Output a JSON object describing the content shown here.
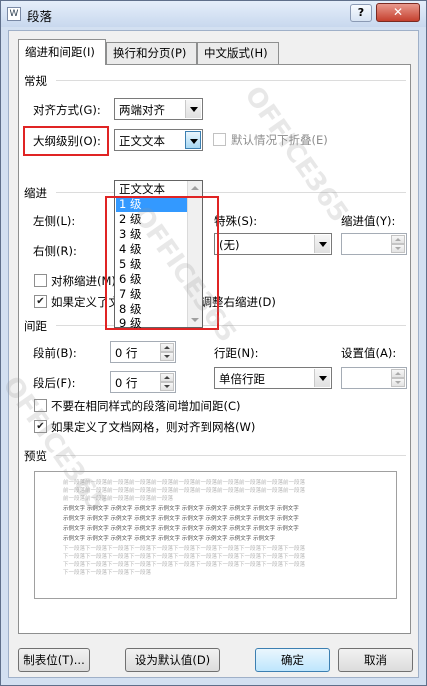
{
  "window": {
    "title": "段落",
    "help_label": "?",
    "close_label": "✕"
  },
  "tabs": [
    {
      "label": "缩进和间距(I)"
    },
    {
      "label": "换行和分页(P)"
    },
    {
      "label": "中文版式(H)"
    }
  ],
  "general": {
    "heading": "常规",
    "alignment_label": "对齐方式(G):",
    "alignment_value": "两端对齐",
    "outline_label": "大纲级别(O):",
    "outline_value": "正文文本",
    "collapsed_label": "默认情况下折叠(E)"
  },
  "outline_dropdown": {
    "options": [
      "正文文本",
      "1 级",
      "2 级",
      "3 级",
      "4 级",
      "5 级",
      "6 级",
      "7 级",
      "8 级",
      "9 级"
    ],
    "selected_index": 1
  },
  "indent": {
    "heading": "缩进",
    "left_label": "左侧(L):",
    "right_label": "右侧(R):",
    "special_label": "特殊(S):",
    "special_value": "(无)",
    "indent_value_label": "缩进值(Y):",
    "mirror_label": "对称缩进(M)",
    "auto_adjust_label": "如果定义了文档网格，则自动调整右缩进(D)"
  },
  "spacing": {
    "heading": "间距",
    "before_label": "段前(B):",
    "before_value": "0 行",
    "after_label": "段后(F):",
    "after_value": "0 行",
    "line_label": "行距(N):",
    "line_value": "单倍行距",
    "set_value_label": "设置值(A):",
    "no_space_same_style_label": "不要在相同样式的段落间增加间距(C)",
    "snap_grid_label": "如果定义了文档网格，则对齐到网格(W)"
  },
  "preview": {
    "heading": "预览",
    "prev_lines": [
      "前一段落前一段落前一段落前一段落前一段落前一段落前一段落前一段落前一段落前一段落前一段落",
      "前一段落前一段落前一段落前一段落前一段落前一段落前一段落前一段落前一段落前一段落前一段落",
      "前一段落前一段落前一段落前一段落前一段落"
    ],
    "sample_lines": [
      "示例文字 示例文字 示例文字 示例文字 示例文字 示例文字 示例文字 示例文字 示例文字 示例文字",
      "示例文字 示例文字 示例文字 示例文字 示例文字 示例文字 示例文字 示例文字 示例文字 示例文字",
      "示例文字 示例文字 示例文字 示例文字 示例文字 示例文字 示例文字 示例文字 示例文字 示例文字",
      "示例文字 示例文字 示例文字 示例文字 示例文字 示例文字 示例文字 示例文字 示例文字"
    ],
    "next_lines": [
      "下一段落下一段落下一段落下一段落下一段落下一段落下一段落下一段落下一段落下一段落下一段落",
      "下一段落下一段落下一段落下一段落下一段落下一段落下一段落下一段落下一段落下一段落下一段落",
      "下一段落下一段落下一段落下一段落下一段落下一段落下一段落下一段落下一段落下一段落下一段落",
      "下一段落下一段落下一段落下一段落"
    ]
  },
  "buttons": {
    "tabs_label": "制表位(T)...",
    "default_label": "设为默认值(D)",
    "ok_label": "确定",
    "cancel_label": "取消"
  },
  "watermark": {
    "text": "OFFICE365"
  }
}
